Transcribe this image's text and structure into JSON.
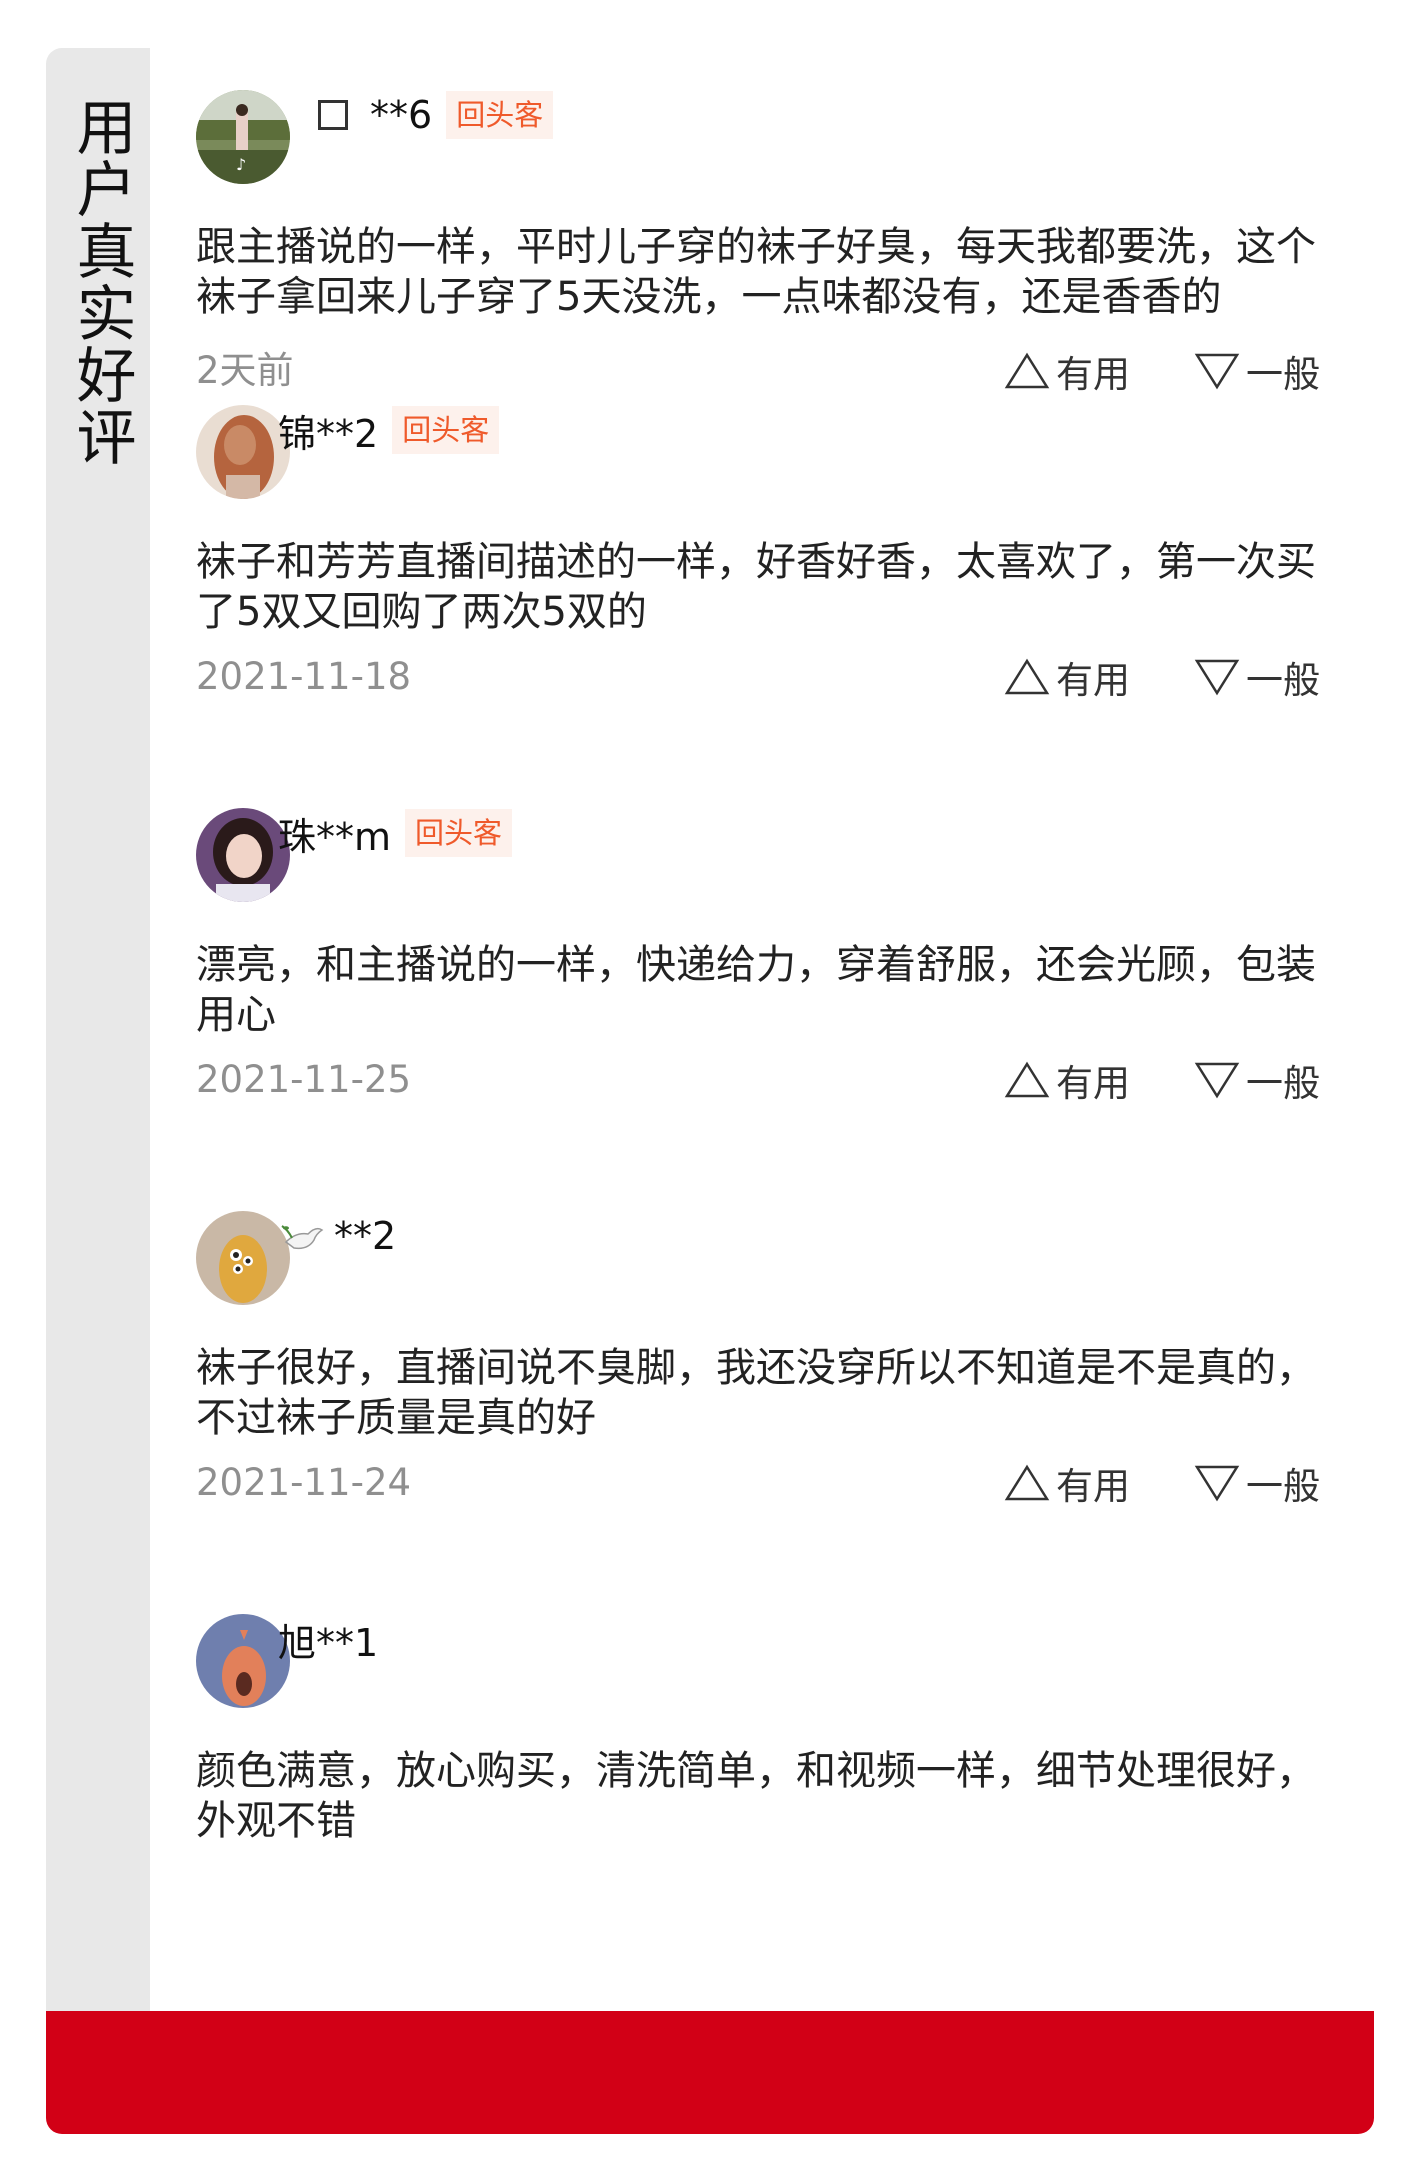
{
  "sidebar": {
    "title": "用户真实好评"
  },
  "reviews": [
    {
      "username": "**6",
      "badge": "回头客",
      "text": "跟主播说的一样，平时儿子穿的袜子好臭，每天我都要洗，这个袜子拿回来儿子穿了5天没洗，一点味都没有，还是香香的",
      "date": "2天前",
      "useful_label": "有用",
      "normal_label": "一般"
    },
    {
      "username": "锦**2",
      "badge": "回头客",
      "text": "袜子和芳芳直播间描述的一样，好香好香，太喜欢了，第一次买了5双又回购了两次5双的",
      "date": "2021-11-18",
      "useful_label": "有用",
      "normal_label": "一般"
    },
    {
      "username": "珠**m",
      "badge": "回头客",
      "text": "漂亮，和主播说的一样，快递给力，穿着舒服，还会光顾，包装用心",
      "date": "2021-11-25",
      "useful_label": "有用",
      "normal_label": "一般"
    },
    {
      "username": "**2",
      "text": "袜子很好，直播间说不臭脚，我还没穿所以不知道是不是真的，不过袜子质量是真的好",
      "date": "2021-11-24",
      "useful_label": "有用",
      "normal_label": "一般"
    },
    {
      "username": "旭**1",
      "text": "颜色满意，放心购买，清洗简单，和视频一样，细节处理很好，外观不错"
    }
  ],
  "colors": {
    "accent_red": "#d20016",
    "badge_text": "#ef5a2b",
    "badge_bg": "#fdf1ec"
  }
}
